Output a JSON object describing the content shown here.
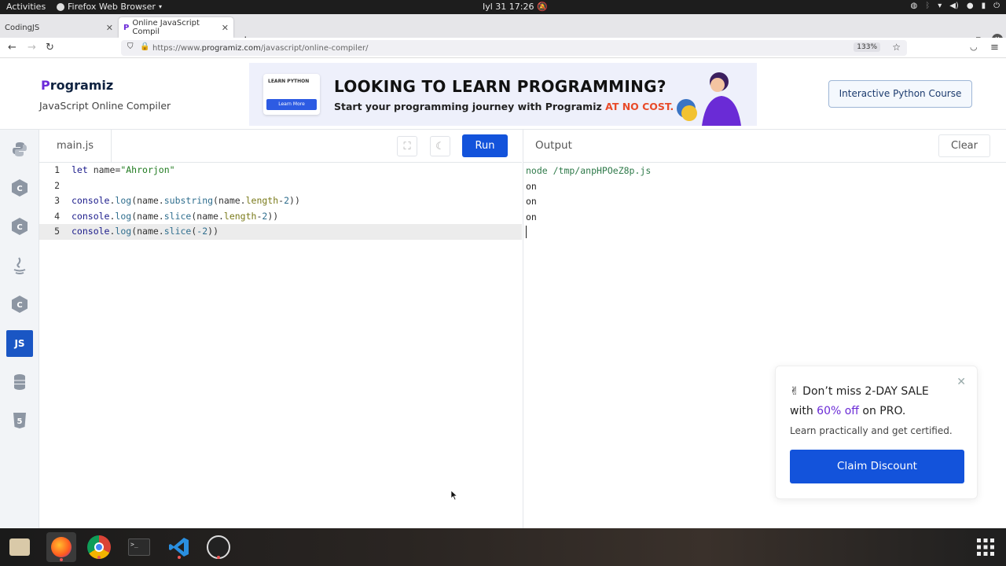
{
  "system": {
    "activities": "Activities",
    "app_name": "Firefox Web Browser",
    "clock": "Iyl 31  17:26"
  },
  "browser": {
    "tabs": [
      {
        "label": "CodingJS"
      },
      {
        "label": "Online JavaScript Compil"
      }
    ],
    "url_prefix": "https://www.",
    "url_domain": "programiz.com",
    "url_path": "/javascript/online-compiler/",
    "zoom": "133%"
  },
  "site": {
    "logo_p": "P",
    "logo_rest": "rogramiz",
    "subtitle": "JavaScript Online Compiler",
    "banner": {
      "card_tag": "LEARN PYTHON",
      "card_button": "Learn More",
      "headline": "LOOKING TO LEARN PROGRAMMING?",
      "line_start": "Start your programming journey with Programiz ",
      "line_highlight": "AT NO COST."
    },
    "cta": "Interactive Python Course",
    "sidebar_active_label": "JS"
  },
  "editor": {
    "file_tab": "main.js",
    "run_label": "Run",
    "lines": [
      {
        "num": "1"
      },
      {
        "num": "2"
      },
      {
        "num": "3"
      },
      {
        "num": "4"
      },
      {
        "num": "5"
      }
    ]
  },
  "output": {
    "title": "Output",
    "clear_label": "Clear",
    "lines": [
      "node /tmp/anpHPOeZ8p.js",
      "on",
      "on",
      "on"
    ]
  },
  "promo": {
    "line1": "✌ Don’t miss 2-DAY SALE",
    "line2_start": "with ",
    "line2_pct": "60% off",
    "line2_end": " on PRO.",
    "line3": "Learn practically and get certified.",
    "button": "Claim Discount"
  },
  "colors": {
    "accent": "#1353db",
    "logo_purple": "#6c2bd9",
    "highlight_orange": "#e84b2a"
  }
}
